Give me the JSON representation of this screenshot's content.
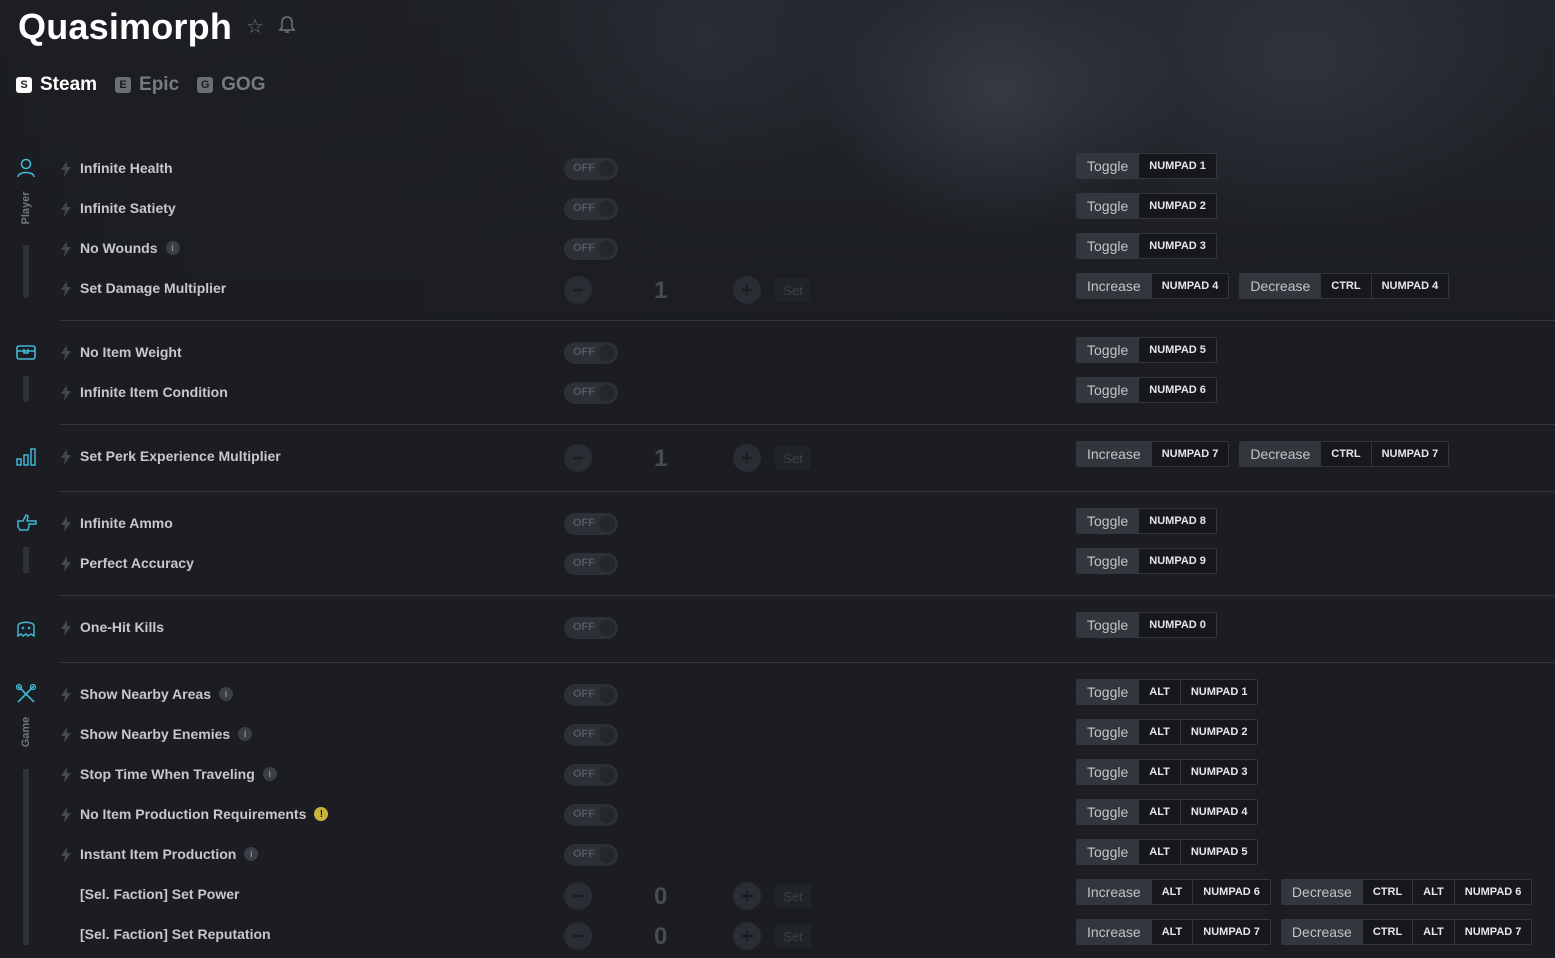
{
  "title": "Quasimorph",
  "header_icons": {
    "favorite": "☆",
    "notify": "🔔"
  },
  "platforms": [
    {
      "label": "Steam",
      "icon": "steam-icon",
      "glyph": "S"
    },
    {
      "label": "Epic",
      "icon": "epic-icon",
      "glyph": "E"
    },
    {
      "label": "GOG",
      "icon": "gog-icon",
      "glyph": "G"
    }
  ],
  "categories": [
    {
      "label": "Player",
      "icon": "user-icon"
    },
    {
      "label": "",
      "icon": "inventory-chest-icon"
    },
    {
      "label": "",
      "icon": "stats-bars-icon"
    },
    {
      "label": "",
      "icon": "gun-hand-icon"
    },
    {
      "label": "",
      "icon": "enemy-ghost-icon"
    },
    {
      "label": "Game",
      "icon": "game-tools-icon"
    }
  ],
  "toggle_off_label": "OFF",
  "set_label": "Set",
  "cheats": [
    {
      "name": "Infinite Health",
      "type": "toggle",
      "hotkeys": [
        {
          "action": "Toggle",
          "keys": [
            "NUMPAD 1"
          ]
        }
      ]
    },
    {
      "name": "Infinite Satiety",
      "type": "toggle",
      "hotkeys": [
        {
          "action": "Toggle",
          "keys": [
            "NUMPAD 2"
          ]
        }
      ]
    },
    {
      "name": "No Wounds",
      "type": "toggle",
      "info": true,
      "hotkeys": [
        {
          "action": "Toggle",
          "keys": [
            "NUMPAD 3"
          ]
        }
      ]
    },
    {
      "name": "Set Damage Multiplier",
      "type": "stepper",
      "value": "1",
      "hotkeys": [
        {
          "action": "Increase",
          "keys": [
            "NUMPAD 4"
          ]
        },
        {
          "action": "Decrease",
          "keys": [
            "CTRL",
            "NUMPAD 4"
          ]
        }
      ]
    },
    {
      "name": "No Item Weight",
      "type": "toggle",
      "hotkeys": [
        {
          "action": "Toggle",
          "keys": [
            "NUMPAD 5"
          ]
        }
      ]
    },
    {
      "name": "Infinite Item Condition",
      "type": "toggle",
      "hotkeys": [
        {
          "action": "Toggle",
          "keys": [
            "NUMPAD 6"
          ]
        }
      ]
    },
    {
      "name": "Set Perk Experience Multiplier",
      "type": "stepper",
      "value": "1",
      "hotkeys": [
        {
          "action": "Increase",
          "keys": [
            "NUMPAD 7"
          ]
        },
        {
          "action": "Decrease",
          "keys": [
            "CTRL",
            "NUMPAD 7"
          ]
        }
      ]
    },
    {
      "name": "Infinite Ammo",
      "type": "toggle",
      "hotkeys": [
        {
          "action": "Toggle",
          "keys": [
            "NUMPAD 8"
          ]
        }
      ]
    },
    {
      "name": "Perfect Accuracy",
      "type": "toggle",
      "hotkeys": [
        {
          "action": "Toggle",
          "keys": [
            "NUMPAD 9"
          ]
        }
      ]
    },
    {
      "name": "One-Hit Kills",
      "type": "toggle",
      "hotkeys": [
        {
          "action": "Toggle",
          "keys": [
            "NUMPAD 0"
          ]
        }
      ]
    },
    {
      "name": "Show Nearby Areas",
      "type": "toggle",
      "info": true,
      "hotkeys": [
        {
          "action": "Toggle",
          "keys": [
            "ALT",
            "NUMPAD 1"
          ]
        }
      ]
    },
    {
      "name": "Show Nearby Enemies",
      "type": "toggle",
      "info": true,
      "hotkeys": [
        {
          "action": "Toggle",
          "keys": [
            "ALT",
            "NUMPAD 2"
          ]
        }
      ]
    },
    {
      "name": "Stop Time When Traveling",
      "type": "toggle",
      "info": true,
      "hotkeys": [
        {
          "action": "Toggle",
          "keys": [
            "ALT",
            "NUMPAD 3"
          ]
        }
      ]
    },
    {
      "name": "No Item Production Requirements",
      "type": "toggle",
      "warning": true,
      "hotkeys": [
        {
          "action": "Toggle",
          "keys": [
            "ALT",
            "NUMPAD 4"
          ]
        }
      ]
    },
    {
      "name": "Instant Item Production",
      "type": "toggle",
      "info": true,
      "hotkeys": [
        {
          "action": "Toggle",
          "keys": [
            "ALT",
            "NUMPAD 5"
          ]
        }
      ]
    },
    {
      "name": "[Sel. Faction] Set Power",
      "type": "stepper",
      "value": "0",
      "no_bolt": true,
      "hotkeys": [
        {
          "action": "Increase",
          "keys": [
            "ALT",
            "NUMPAD 6"
          ]
        },
        {
          "action": "Decrease",
          "keys": [
            "CTRL",
            "ALT",
            "NUMPAD 6"
          ]
        }
      ]
    },
    {
      "name": "[Sel. Faction] Set Reputation",
      "type": "stepper",
      "value": "0",
      "no_bolt": true,
      "hotkeys": [
        {
          "action": "Increase",
          "keys": [
            "ALT",
            "NUMPAD 7"
          ]
        },
        {
          "action": "Decrease",
          "keys": [
            "CTRL",
            "ALT",
            "NUMPAD 7"
          ]
        }
      ]
    }
  ]
}
